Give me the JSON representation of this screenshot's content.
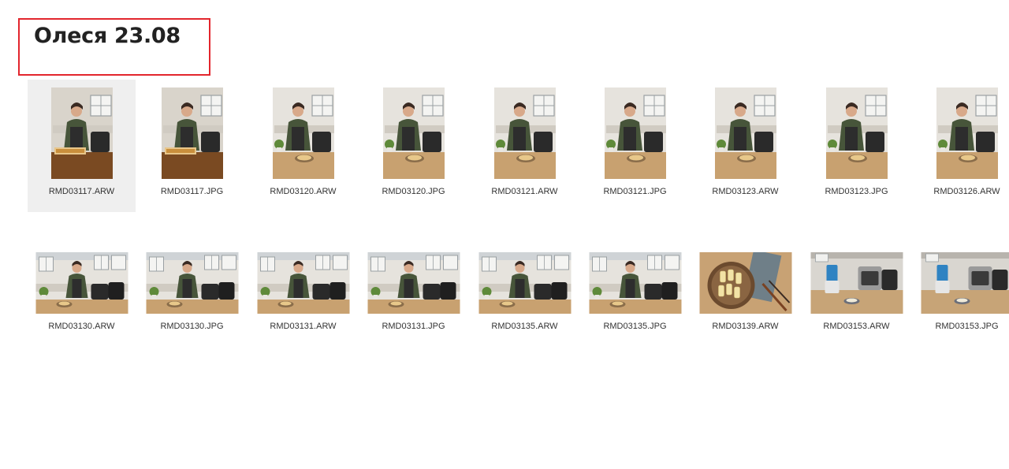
{
  "folder": {
    "title": "Олеся 23.08"
  },
  "colors": {
    "highlight": "#e3262d",
    "selected_bg": "#efefef"
  },
  "rows": [
    {
      "items": [
        {
          "name": "RMD03117.ARW",
          "scene": "kitchen-dark",
          "orientation": "portrait",
          "selected": true
        },
        {
          "name": "RMD03117.JPG",
          "scene": "kitchen-dark",
          "orientation": "portrait"
        },
        {
          "name": "RMD03120.ARW",
          "scene": "kitchen",
          "orientation": "portrait"
        },
        {
          "name": "RMD03120.JPG",
          "scene": "kitchen",
          "orientation": "portrait"
        },
        {
          "name": "RMD03121.ARW",
          "scene": "kitchen",
          "orientation": "portrait"
        },
        {
          "name": "RMD03121.JPG",
          "scene": "kitchen",
          "orientation": "portrait"
        },
        {
          "name": "RMD03123.ARW",
          "scene": "kitchen",
          "orientation": "portrait"
        },
        {
          "name": "RMD03123.JPG",
          "scene": "kitchen",
          "orientation": "portrait"
        },
        {
          "name": "RMD03126.ARW",
          "scene": "kitchen",
          "orientation": "portrait"
        }
      ]
    },
    {
      "items": [
        {
          "name": "RMD03130.ARW",
          "scene": "kitchen",
          "orientation": "landscape"
        },
        {
          "name": "RMD03130.JPG",
          "scene": "kitchen",
          "orientation": "landscape"
        },
        {
          "name": "RMD03131.ARW",
          "scene": "kitchen",
          "orientation": "landscape"
        },
        {
          "name": "RMD03131.JPG",
          "scene": "kitchen",
          "orientation": "landscape"
        },
        {
          "name": "RMD03135.ARW",
          "scene": "kitchen",
          "orientation": "landscape"
        },
        {
          "name": "RMD03135.JPG",
          "scene": "kitchen",
          "orientation": "landscape"
        },
        {
          "name": "RMD03139.ARW",
          "scene": "food-plate",
          "orientation": "landscape"
        },
        {
          "name": "RMD03153.ARW",
          "scene": "appliances",
          "orientation": "landscape"
        },
        {
          "name": "RMD03153.JPG",
          "scene": "appliances",
          "orientation": "landscape"
        }
      ]
    }
  ]
}
